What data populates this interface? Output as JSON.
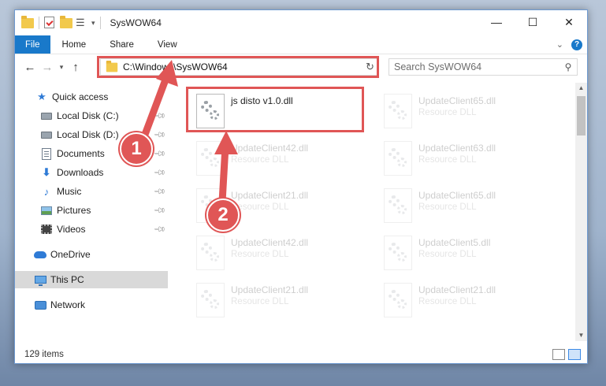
{
  "window": {
    "title": "SysWOW64",
    "controls": {
      "minimize": "—",
      "maximize": "☐",
      "close": "✕"
    }
  },
  "ribbon": {
    "tabs": [
      "File",
      "Home",
      "Share",
      "View"
    ],
    "expand_icon": "chevron-down-icon",
    "help_label": "?"
  },
  "nav": {
    "address": "C:\\Windows\\SysWOW64",
    "search_placeholder": "Search SysWOW64"
  },
  "sidebar": {
    "items": [
      {
        "label": "Quick access",
        "icon": "star-icon"
      },
      {
        "label": "Local Disk (C:)",
        "icon": "drive-icon"
      },
      {
        "label": "Local Disk (D:)",
        "icon": "drive-icon"
      },
      {
        "label": "Documents",
        "icon": "documents-icon"
      },
      {
        "label": "Downloads",
        "icon": "downloads-icon"
      },
      {
        "label": "Music",
        "icon": "music-icon"
      },
      {
        "label": "Pictures",
        "icon": "pictures-icon"
      },
      {
        "label": "Videos",
        "icon": "videos-icon"
      },
      {
        "label": "OneDrive",
        "icon": "onedrive-icon"
      },
      {
        "label": "This PC",
        "icon": "this-pc-icon"
      },
      {
        "label": "Network",
        "icon": "network-icon"
      }
    ],
    "selected": "This PC"
  },
  "files": {
    "col1": [
      {
        "name": "js disto v1.0.dll",
        "type": ""
      },
      {
        "name": "UpdateClient42.dll",
        "type": "Resource DLL"
      },
      {
        "name": "UpdateClient21.dll",
        "type": "Resource DLL"
      },
      {
        "name": "UpdateClient42.dll",
        "type": "Resource DLL"
      },
      {
        "name": "UpdateClient21.dll",
        "type": "Resource DLL"
      }
    ],
    "col2": [
      {
        "name": "UpdateClient65.dll",
        "type": "Resource DLL"
      },
      {
        "name": "UpdateClient63.dll",
        "type": "Resource DLL"
      },
      {
        "name": "UpdateClient65.dll",
        "type": "Resource DLL"
      },
      {
        "name": "UpdateClient5.dll",
        "type": "Resource DLL"
      },
      {
        "name": "UpdateClient21.dll",
        "type": "Resource DLL"
      }
    ]
  },
  "status": {
    "item_count": "129 items"
  },
  "annotations": {
    "step1": "1",
    "step2": "2",
    "color": "#e05656"
  }
}
